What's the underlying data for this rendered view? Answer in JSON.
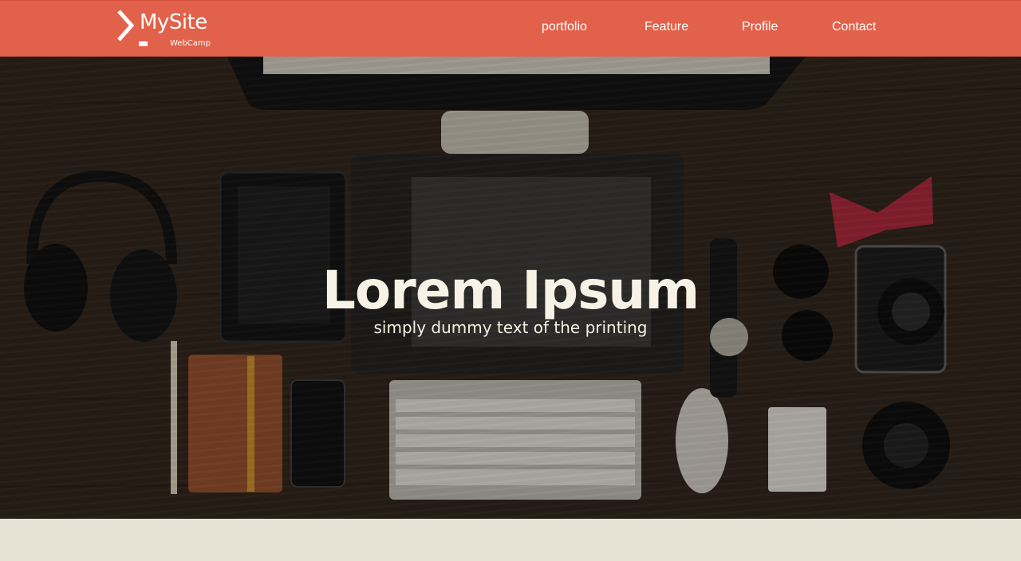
{
  "header": {
    "logo": {
      "name": "MySite",
      "sub": "WebCamp"
    },
    "nav": [
      "portfolio",
      "Feature",
      "Profile",
      "Contact"
    ]
  },
  "hero": {
    "title": "Lorem Ipsum",
    "subtitle": "simply dummy text of the printing",
    "background_image": "desk-flatlay-photo"
  },
  "colors": {
    "header_bg": "#e2614a",
    "page_bg": "#e8e2d4",
    "hero_text": "#f7f2e6"
  }
}
